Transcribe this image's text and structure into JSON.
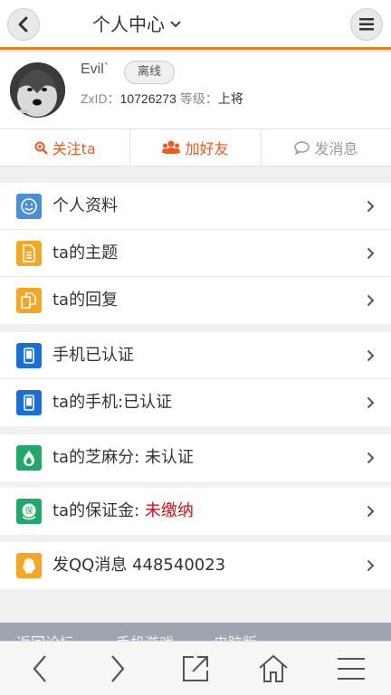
{
  "header": {
    "back_icon": "chevron-left-icon",
    "title": "个人中心",
    "title_dropdown_icon": "chevron-down-icon",
    "menu_icon": "hamburger-menu-icon",
    "accent_color": "#f47a20"
  },
  "profile": {
    "username": "Evil`",
    "status": "离线",
    "zxid_label": "ZxID：",
    "zxid_value": "10726273",
    "level_label": "等级：",
    "level_value": "上将"
  },
  "actions": [
    {
      "label": "关注ta",
      "icon": "search-plus-icon"
    },
    {
      "label": "加好友",
      "icon": "users-icon"
    },
    {
      "label": "发消息",
      "icon": "chat-bubble-icon"
    }
  ],
  "groups": [
    {
      "items": [
        {
          "label": "个人资料",
          "icon": "smiley-icon",
          "color": "#4a90d9"
        },
        {
          "label": "ta的主题",
          "icon": "document-icon",
          "color": "#f5a623"
        },
        {
          "label": "ta的回复",
          "icon": "copy-icon",
          "color": "#f5a623"
        }
      ]
    },
    {
      "items": [
        {
          "label": "手机已认证",
          "icon": "mobile-icon",
          "color": "#1a6fd6"
        },
        {
          "label": "ta的手机:已认证",
          "icon": "mobile-icon",
          "color": "#1a6fd6"
        }
      ]
    },
    {
      "items": [
        {
          "label": "ta的芝麻分: 未认证",
          "icon": "sesame-icon",
          "color": "#21a96b"
        }
      ]
    },
    {
      "items": [
        {
          "label": "ta的保证金: ",
          "label_emphasis": "未缴纳",
          "icon": "deposit-shield-icon",
          "color": "#21a96b"
        }
      ]
    },
    {
      "items": [
        {
          "label": "发QQ消息 448540023",
          "icon": "qq-icon",
          "color": "#f5a623"
        }
      ]
    }
  ],
  "footer_links": [
    "返回论坛",
    "手机游戏",
    "电脑版"
  ],
  "bottom_nav": [
    {
      "name": "back",
      "icon": "arrow-left-icon"
    },
    {
      "name": "forward",
      "icon": "arrow-right-icon"
    },
    {
      "name": "share",
      "icon": "share-icon"
    },
    {
      "name": "home",
      "icon": "home-icon"
    },
    {
      "name": "menu",
      "icon": "menu-icon"
    }
  ]
}
